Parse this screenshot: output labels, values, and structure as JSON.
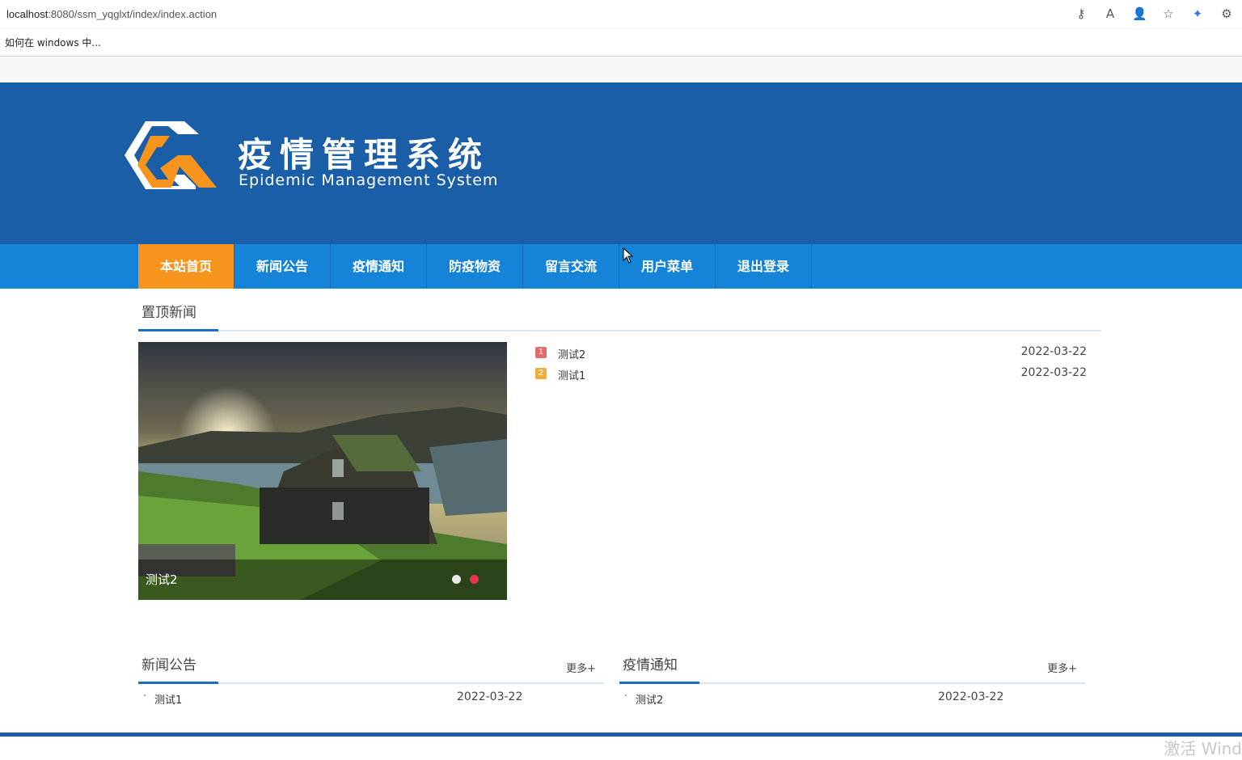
{
  "browser": {
    "url_host": "localhost",
    "url_rest": ":8080/ssm_yqglxt/index/index.action",
    "bookmark": "如何在 windows 中...",
    "icons": [
      "key-icon",
      "read-aloud-icon",
      "person-icon",
      "favorites-icon",
      "extension-icon",
      "settings-icon"
    ]
  },
  "header": {
    "title": "疫情管理系统",
    "subtitle": "Epidemic Management System",
    "colors": {
      "header_bg": "#1b5ea8",
      "logo_orange": "#f7941d",
      "logo_white": "#ffffff"
    }
  },
  "nav": {
    "items": [
      "本站首页",
      "新闻公告",
      "疫情通知",
      "防疫物资",
      "留言交流",
      "用户菜单",
      "退出登录"
    ],
    "active_index": 0,
    "colors": {
      "bar": "#1583d7",
      "active": "#f7941d"
    }
  },
  "top_news": {
    "title": "置顶新闻",
    "slider": {
      "caption": "测试2",
      "dot_count": 2,
      "active_dot": 1
    },
    "items": [
      {
        "rank": "1",
        "title": "测试2",
        "date": "2022-03-22"
      },
      {
        "rank": "2",
        "title": "测试1",
        "date": "2022-03-22"
      }
    ]
  },
  "news": {
    "title": "新闻公告",
    "more": "更多+",
    "items": [
      {
        "bullet": "·",
        "title": "测试1",
        "date": "2022-03-22"
      }
    ]
  },
  "epidemic": {
    "title": "疫情通知",
    "more": "更多+",
    "items": [
      {
        "bullet": "·",
        "title": "测试2",
        "date": "2022-03-22"
      }
    ]
  },
  "watermark": "激活 Wind"
}
